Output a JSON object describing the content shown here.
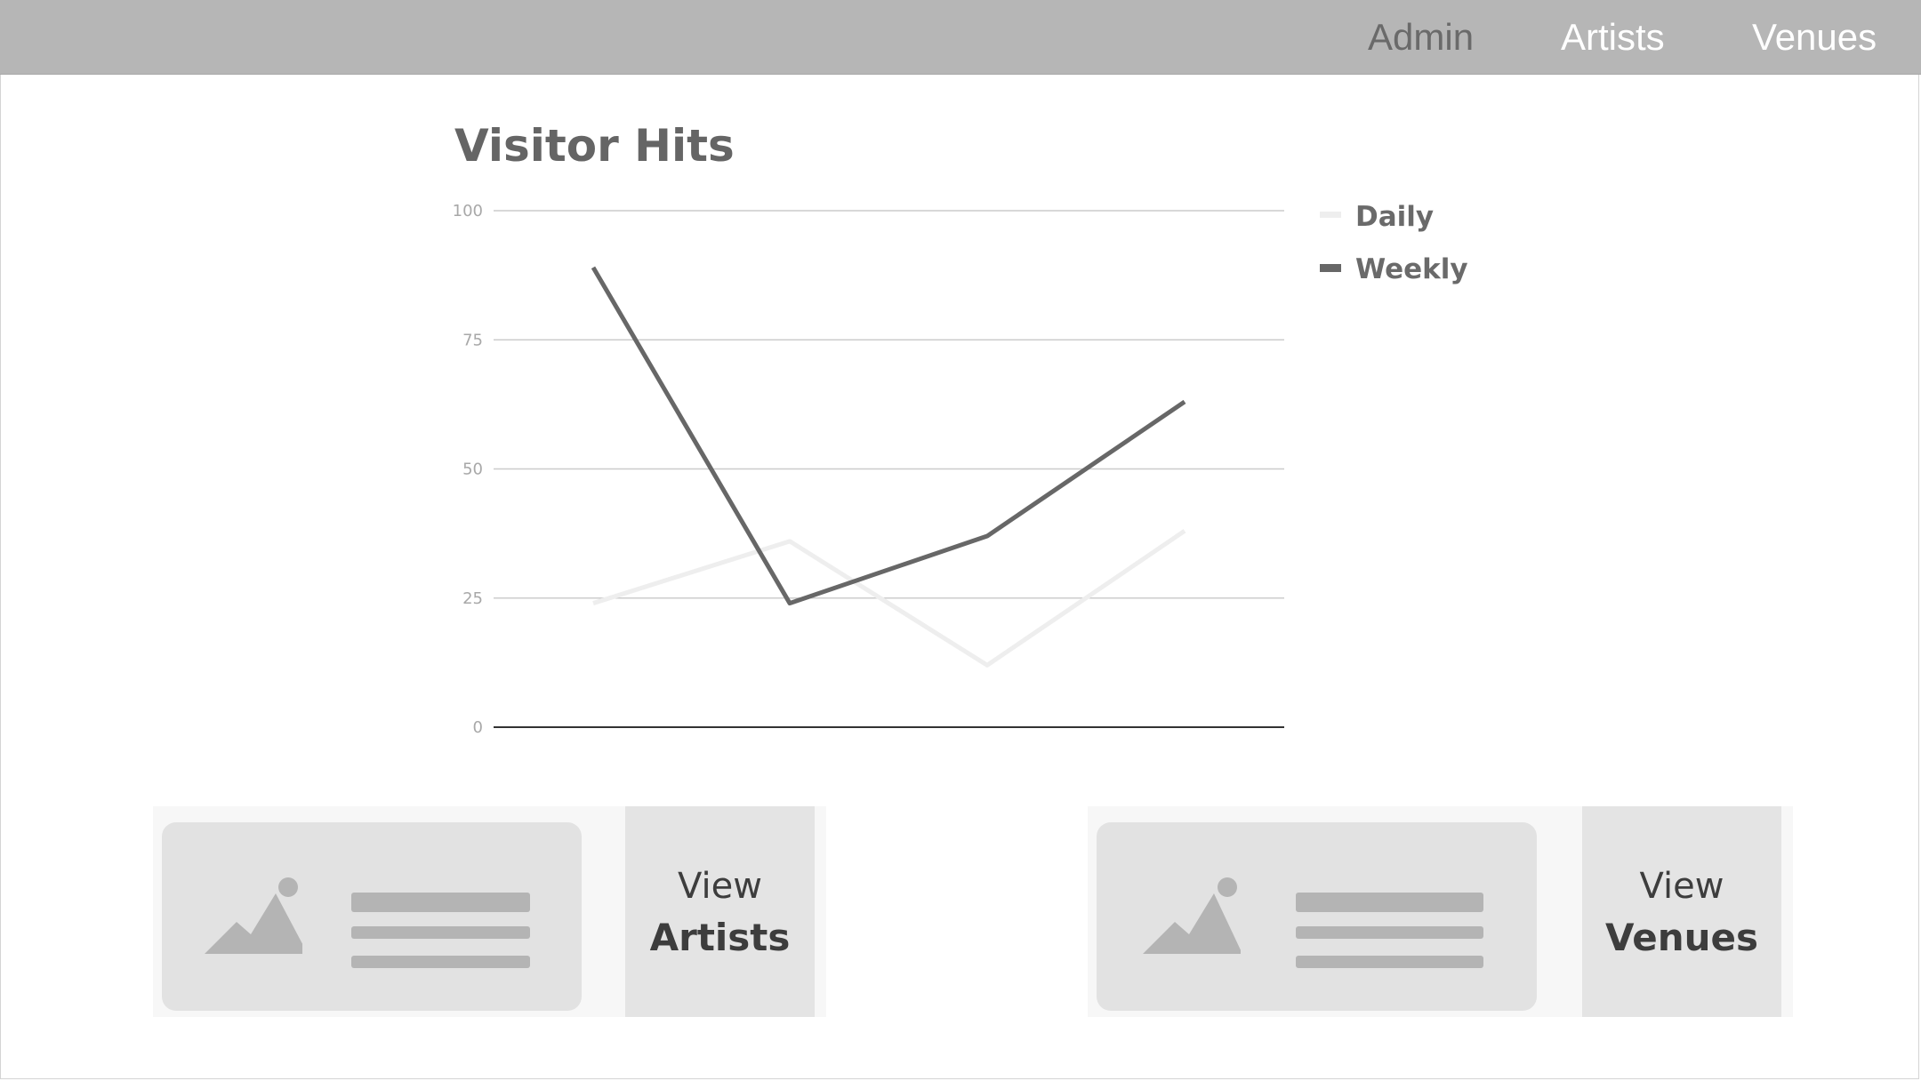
{
  "nav": {
    "items": [
      {
        "label": "Admin"
      },
      {
        "label": "Artists"
      },
      {
        "label": "Venues"
      }
    ],
    "bar_color": "#b6b6b6"
  },
  "chart_data": {
    "type": "line",
    "title": "Visitor Hits",
    "xlabel": "",
    "ylabel": "",
    "ylim": [
      0,
      100
    ],
    "yticks": [
      "0",
      "25",
      "50",
      "75",
      "100"
    ],
    "grid": true,
    "legend_position": "right",
    "x": [
      1,
      2,
      3,
      4
    ],
    "series": [
      {
        "name": "Daily",
        "values": [
          24,
          36,
          12,
          38
        ],
        "color": "#eeeeee"
      },
      {
        "name": "Weekly",
        "values": [
          89,
          24,
          37,
          63
        ],
        "color": "#676767"
      }
    ]
  },
  "cards": [
    {
      "action_top": "View",
      "action_bottom": "Artists",
      "image_icon": "image-placeholder-icon"
    },
    {
      "action_top": "View",
      "action_bottom": "Venues",
      "image_icon": "image-placeholder-icon"
    }
  ]
}
